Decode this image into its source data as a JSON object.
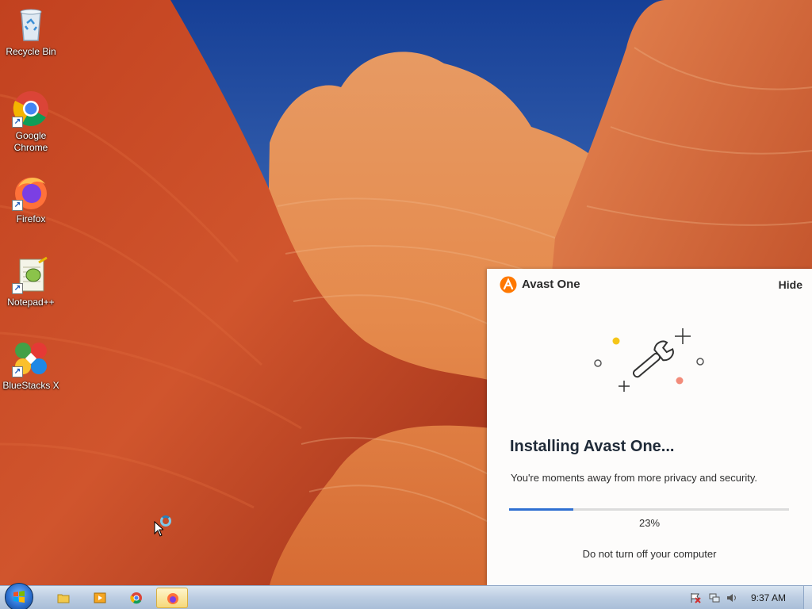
{
  "desktop": {
    "icons": [
      {
        "label": "Recycle Bin",
        "icon": "recycle-bin-icon"
      },
      {
        "label": "Google Chrome",
        "icon": "chrome-icon"
      },
      {
        "label": "Firefox",
        "icon": "firefox-icon"
      },
      {
        "label": "Notepad++",
        "icon": "notepad-plus-plus-icon"
      },
      {
        "label": "BlueStacks X",
        "icon": "bluestacks-icon"
      }
    ]
  },
  "avast": {
    "title": "Avast One",
    "hide_label": "Hide",
    "heading": "Installing Avast One...",
    "subtitle": "You're moments away from more privacy and security.",
    "progress_percent": 23,
    "progress_text": "23%",
    "warning": "Do not turn off your computer",
    "accent_color": "#ff7800",
    "progress_color": "#2e6fd1"
  },
  "taskbar": {
    "pinned": [
      {
        "name": "explorer",
        "icon": "folder-icon"
      },
      {
        "name": "media-player",
        "icon": "media-player-icon"
      },
      {
        "name": "chrome",
        "icon": "chrome-icon"
      },
      {
        "name": "firefox",
        "icon": "firefox-icon",
        "active": true
      }
    ],
    "tray_icons": [
      "action-center-flag-icon",
      "network-icon",
      "volume-icon"
    ],
    "clock": "9:37 AM"
  }
}
